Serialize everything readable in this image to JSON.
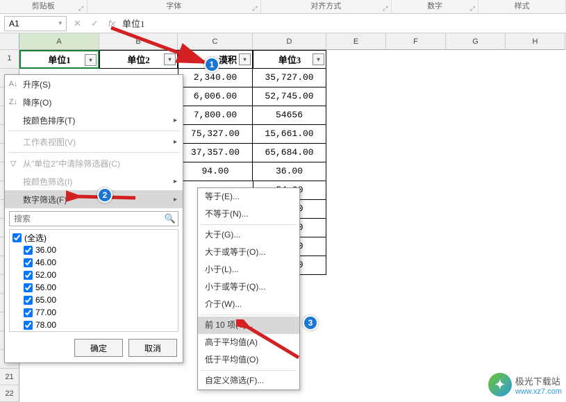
{
  "ribbon": {
    "groups": [
      "剪贴板",
      "字体",
      "对齐方式",
      "数字",
      "样式"
    ]
  },
  "namebox": {
    "cell": "A1",
    "formula": "单位1"
  },
  "columns": [
    "A",
    "B",
    "C",
    "D",
    "E",
    "F",
    "G",
    "H"
  ],
  "rows_visible": [
    "1",
    "",
    "",
    "",
    "",
    "",
    "",
    "",
    "",
    "",
    "",
    "21",
    "22"
  ],
  "headers": {
    "A": "单位1",
    "B": "单位2",
    "C_suffix": "漠积",
    "D": "单位3"
  },
  "chart_data": {
    "type": "table",
    "columns": [
      "C",
      "D"
    ],
    "rows": [
      [
        "2,340.00",
        "35,727.00"
      ],
      [
        "6,006.00",
        "52,745.00"
      ],
      [
        "7,800.00",
        "54656"
      ],
      [
        "75,327.00",
        "15,661.00"
      ],
      [
        "37,357.00",
        "65,684.00"
      ],
      [
        "94.00",
        "36.00"
      ],
      [
        "",
        "54.00"
      ],
      [
        "",
        "75.00"
      ],
      [
        "",
        "95.00"
      ],
      [
        "",
        "61.00"
      ],
      [
        "",
        "42.00"
      ]
    ]
  },
  "filter_menu": {
    "sort_asc": "升序(S)",
    "sort_desc": "降序(O)",
    "sort_color": "按颜色排序(T)",
    "sheet_view": "工作表视图(V)",
    "clear_filter": "从\"单位2\"中清除筛选器(C)",
    "filter_color": "按颜色筛选(I)",
    "number_filter": "数字筛选(F)",
    "search_placeholder": "搜索",
    "select_all": "(全选)",
    "values": [
      "36.00",
      "46.00",
      "52.00",
      "56.00",
      "65.00",
      "77.00",
      "78.00"
    ],
    "ok": "确定",
    "cancel": "取消"
  },
  "submenu": {
    "eq": "等于(E)...",
    "neq": "不等于(N)...",
    "gt": "大于(G)...",
    "gte": "大于或等于(O)...",
    "lt": "小于(L)...",
    "lte": "小于或等于(Q)...",
    "between": "介于(W)...",
    "top10": "前 10 项(T)...",
    "above_avg": "高于平均值(A)",
    "below_avg": "低于平均值(O)",
    "custom": "自定义筛选(F)..."
  },
  "badges": {
    "b1": "1",
    "b2": "2",
    "b3": "3"
  },
  "watermark": {
    "name": "极光下载站",
    "url": "www.xz7.com"
  }
}
